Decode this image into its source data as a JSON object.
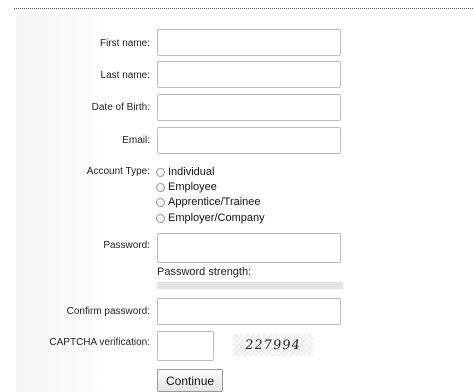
{
  "form": {
    "first_name": {
      "label": "First name:",
      "value": ""
    },
    "last_name": {
      "label": "Last name:",
      "value": ""
    },
    "dob": {
      "label": "Date of Birth:",
      "value": ""
    },
    "email": {
      "label": "Email:",
      "value": ""
    },
    "account_type": {
      "label": "Account Type:",
      "options": [
        "Individual",
        "Employee",
        "Apprentice/Trainee",
        "Employer/Company"
      ],
      "selected": null
    },
    "password": {
      "label": "Password:",
      "value": "",
      "strength_label": "Password strength:",
      "strength_fraction": 0
    },
    "confirm_password": {
      "label": "Confirm password:",
      "value": ""
    },
    "captcha": {
      "label": "CAPTCHA verification:",
      "value": "",
      "image_text": "227994"
    },
    "submit_label": "Continue"
  }
}
